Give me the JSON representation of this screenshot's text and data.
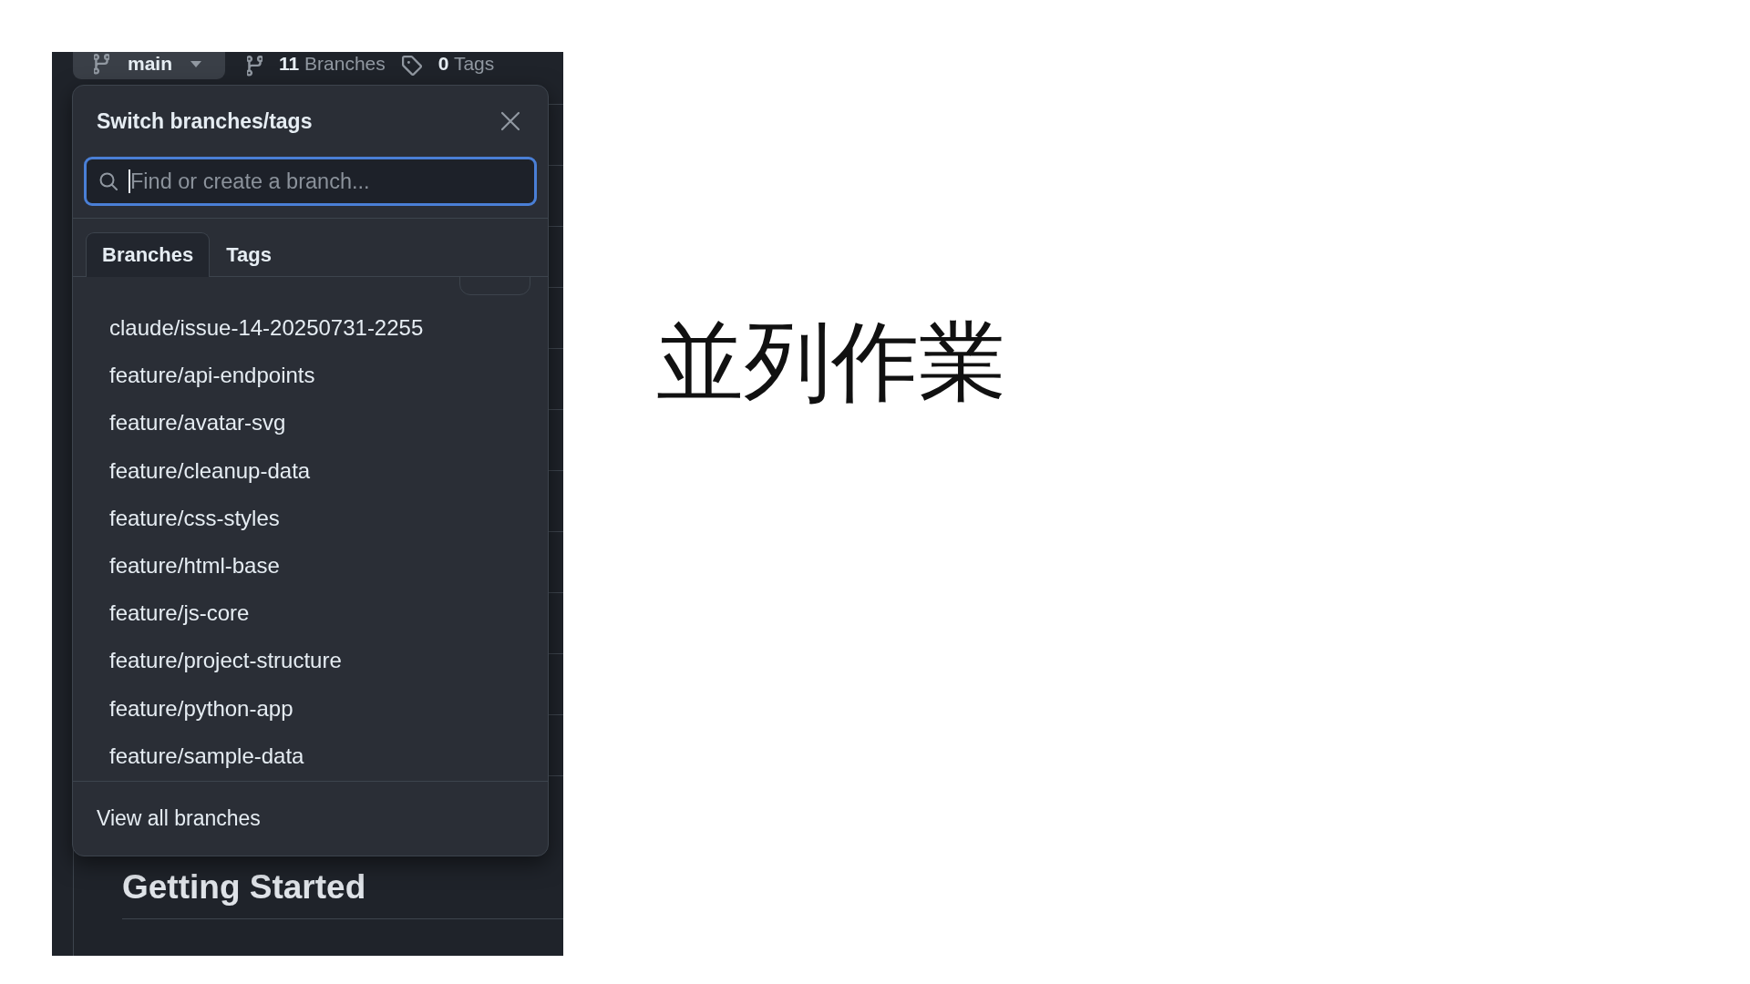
{
  "slide": {
    "screenshot": {
      "repo_bar": {
        "branch_selector": {
          "label": "main"
        },
        "branches_link": "**11** Branches",
        "tags_link": "**0** Tags"
      },
      "branch_menu": {
        "title": "Switch branches/tags",
        "search": {
          "placeholder": "Find or create a branch...",
          "focused": true
        },
        "tabs": [
          {
            "label": "Branches",
            "selected": true
          },
          {
            "label": "Tags",
            "selected": false
          }
        ],
        "branches": [
          {
            "name": "claude/issue-14-20250731-2255"
          },
          {
            "name": "feature/api-endpoints"
          },
          {
            "name": "feature/avatar-svg"
          },
          {
            "name": "feature/cleanup-data"
          },
          {
            "name": "feature/css-styles"
          },
          {
            "name": "feature/html-base"
          },
          {
            "name": "feature/js-core"
          },
          {
            "name": "feature/project-structure"
          },
          {
            "name": "feature/python-app"
          },
          {
            "name": "feature/sample-data"
          }
        ],
        "footer_link": "View all branches"
      },
      "readme": {
        "heading": "Getting Started"
      }
    },
    "title": "並列作業"
  }
}
